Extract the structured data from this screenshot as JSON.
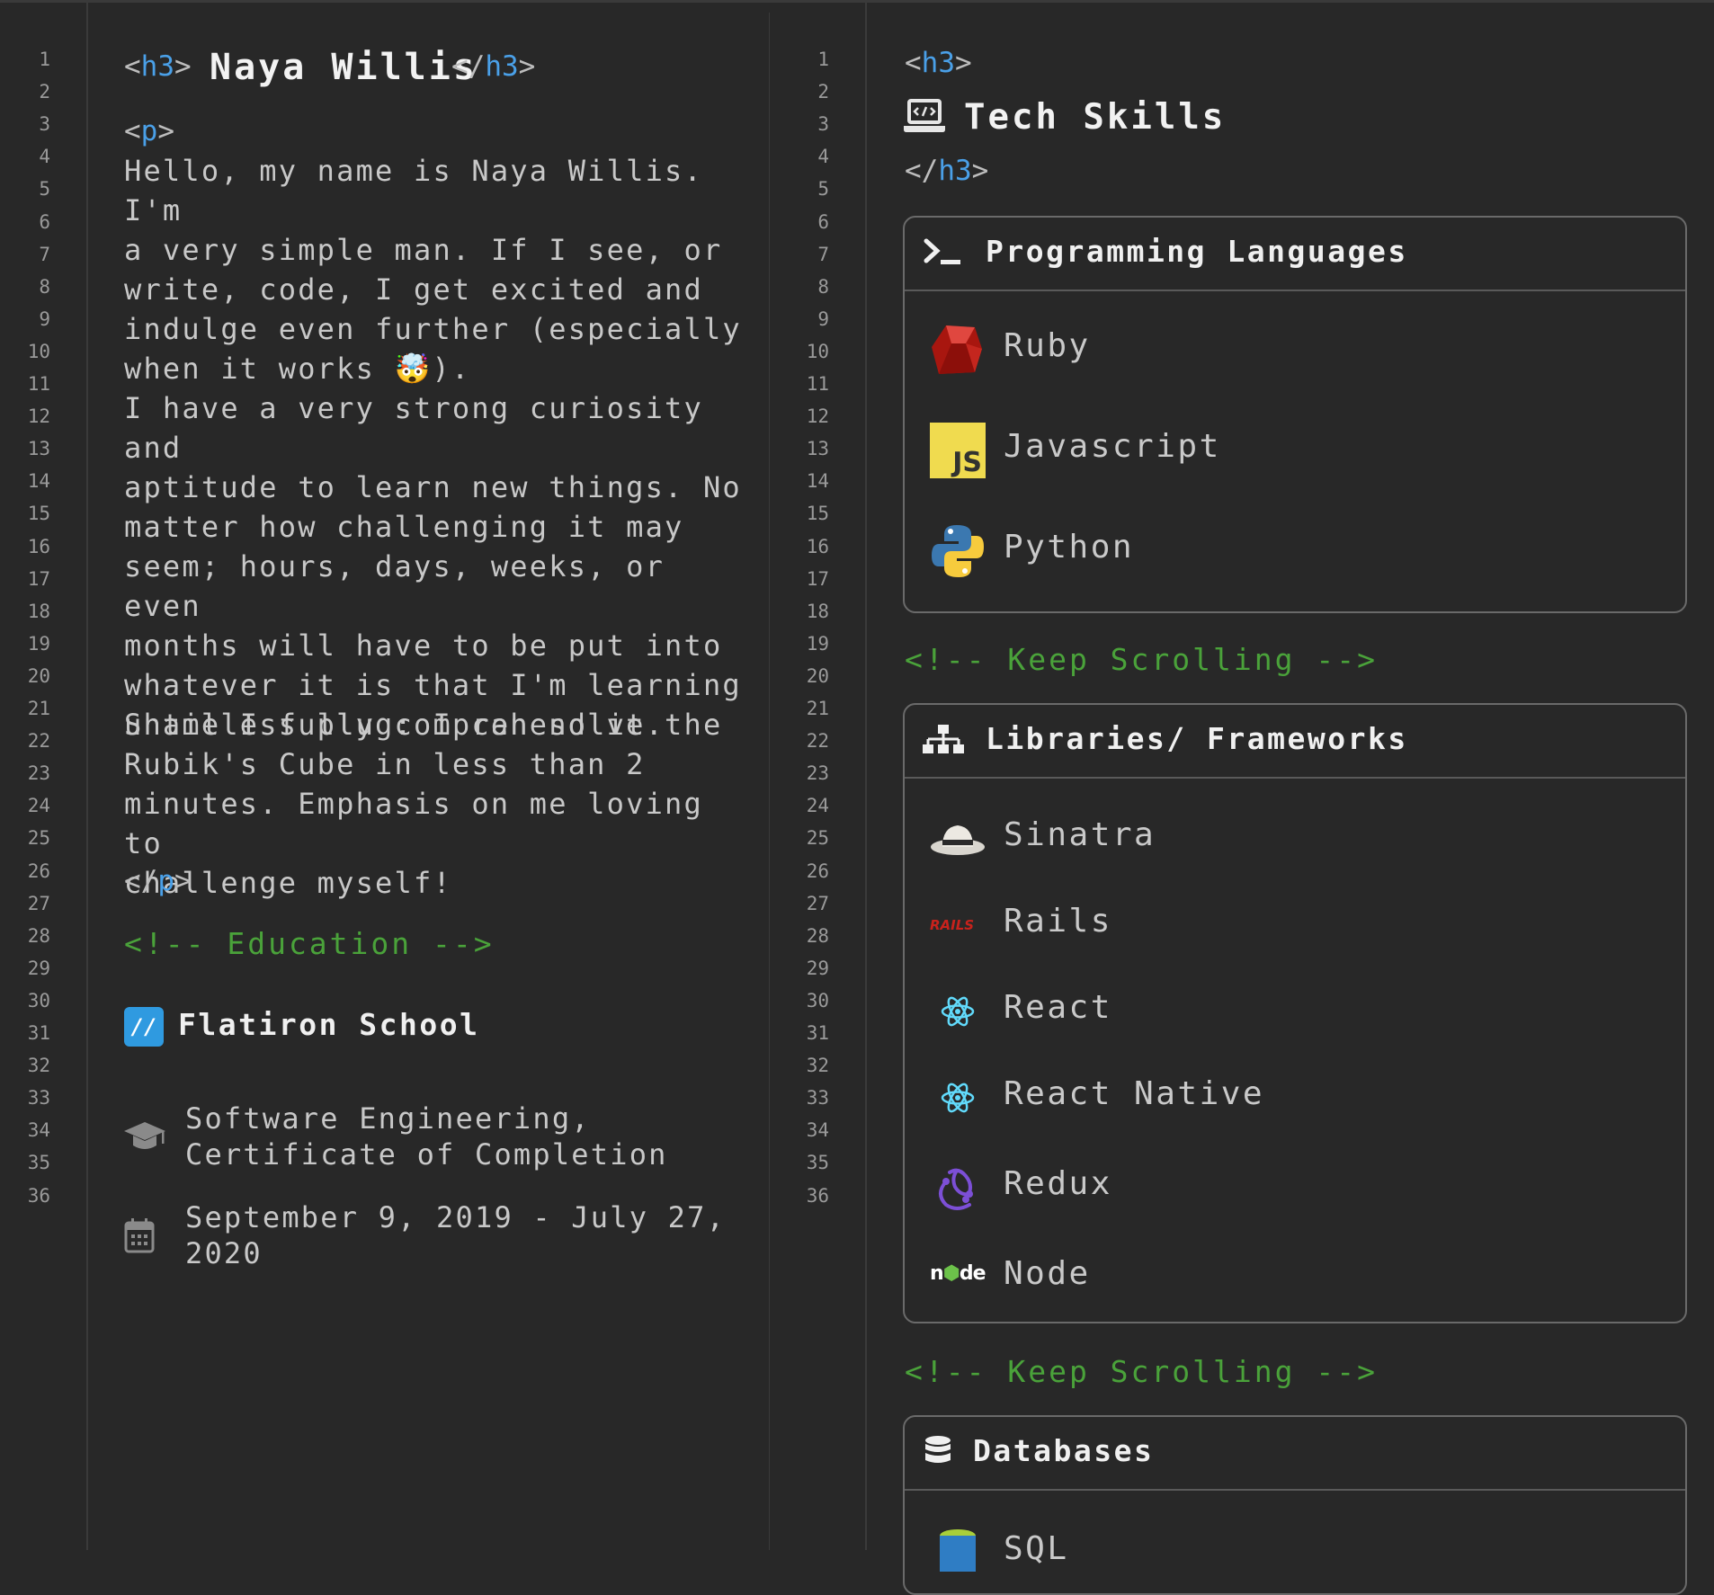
{
  "left_pane": {
    "heading": {
      "open_tag": "h3",
      "text": "Naya Willis",
      "close_tag": "h3"
    },
    "paragraph_tag": "p",
    "paragraphs": [
      "Hello, my name is Naya Willis. I'm\na very simple man. If I see, or\nwrite, code, I get excited and\nindulge even further (especially\nwhen it works 🤯).",
      "I have a very strong curiosity and\naptitude to learn new things. No\nmatter how challenging it may\nseem; hours, days, weeks, or even\nmonths will have to be put into\nwhatever it is that I'm learning\nuntil I fully comprehend it.",
      "Shameless plug: I can solve the\nRubik's Cube in less than 2\nminutes. Emphasis on me loving to\nchallenge myself!"
    ],
    "education_comment": "<!-- Education -->",
    "school": {
      "icon": "flatiron-logo-icon",
      "name": "Flatiron School"
    },
    "degree": {
      "icon": "graduation-cap-icon",
      "text": "Software Engineering,\nCertificate of Completion"
    },
    "dates": {
      "icon": "calendar-icon",
      "text": "September 9, 2019 - July 27,\n2020"
    }
  },
  "right_pane": {
    "heading": {
      "open_tag": "h3",
      "icon": "laptop-code-icon",
      "text": "Tech Skills",
      "close_tag": "h3"
    },
    "scroll_comment": "<!-- Keep Scrolling -->",
    "cards": [
      {
        "title": "Programming Languages",
        "icon": "terminal-icon",
        "items": [
          {
            "label": "Ruby",
            "icon": "ruby-icon"
          },
          {
            "label": "Javascript",
            "icon": "javascript-icon"
          },
          {
            "label": "Python",
            "icon": "python-icon"
          }
        ]
      },
      {
        "title": "Libraries/ Frameworks",
        "icon": "sitemap-icon",
        "items": [
          {
            "label": "Sinatra",
            "icon": "sinatra-hat-icon"
          },
          {
            "label": "Rails",
            "icon": "rails-icon"
          },
          {
            "label": "React",
            "icon": "react-icon"
          },
          {
            "label": "React Native",
            "icon": "react-native-icon"
          },
          {
            "label": "Redux",
            "icon": "redux-icon"
          },
          {
            "label": "Node",
            "icon": "node-icon"
          }
        ]
      },
      {
        "title": "Databases",
        "icon": "database-icon",
        "items": [
          {
            "label": "SQL",
            "icon": "sql-database-icon"
          }
        ]
      }
    ]
  },
  "line_numbers": [
    "1",
    "2",
    "3",
    "4",
    "5",
    "6",
    "7",
    "8",
    "9",
    "10",
    "11",
    "12",
    "13",
    "14",
    "15",
    "16",
    "17",
    "18",
    "19",
    "20",
    "21",
    "22",
    "23",
    "24",
    "25",
    "26",
    "27",
    "28",
    "29",
    "30",
    "31",
    "32",
    "33",
    "34",
    "35",
    "36"
  ],
  "glyphs": {
    "lt": "<",
    "gt": ">",
    "slash": "/",
    "js": "JS",
    "rails": "RAILS",
    "flatiron": "//",
    "node_n": "n",
    "node_de": "de"
  },
  "colors": {
    "background": "#282828",
    "tag_name": "#4aa0e8",
    "comment": "#4aa23a",
    "text": "#c9c9c9",
    "heading": "#f2f2f2"
  }
}
